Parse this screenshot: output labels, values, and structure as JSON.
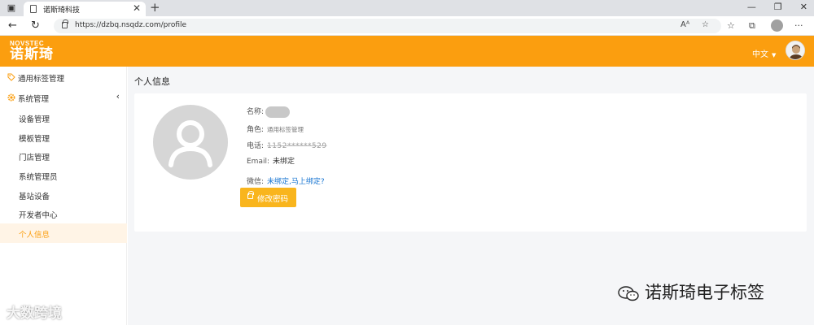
{
  "browser": {
    "tab_title": "诺斯琦科技",
    "url": "https://dzbq.nsqdz.com/profile",
    "new_tab_symbol": "+",
    "tab_close_symbol": "✕"
  },
  "header": {
    "logo_en": "NOVSTEC",
    "logo_cn": "诺斯琦",
    "language": "中文",
    "brand_color": "#fb9e0f"
  },
  "sidebar": {
    "group_tags": "通用标签管理",
    "group_system": "系统管理",
    "items": [
      {
        "label": "设备管理"
      },
      {
        "label": "模板管理"
      },
      {
        "label": "门店管理"
      },
      {
        "label": "系统管理员"
      },
      {
        "label": "基站设备"
      },
      {
        "label": "开发者中心"
      },
      {
        "label": "个人信息"
      }
    ],
    "active_index": 6
  },
  "main": {
    "page_title": "个人信息",
    "name_label": "名称:",
    "role_label": "角色:",
    "role_value": "通用标签管理",
    "phone_label": "电话:",
    "phone_value": "1152******529",
    "email_label": "Email:",
    "email_value": "未绑定",
    "wechat_label": "微信:",
    "wechat_value": "未绑定,马上绑定?",
    "change_password": "修改密码",
    "button_color": "#f9b51d"
  },
  "watermarks": {
    "left": "大数跨境",
    "right": "诺斯琦电子标签"
  }
}
